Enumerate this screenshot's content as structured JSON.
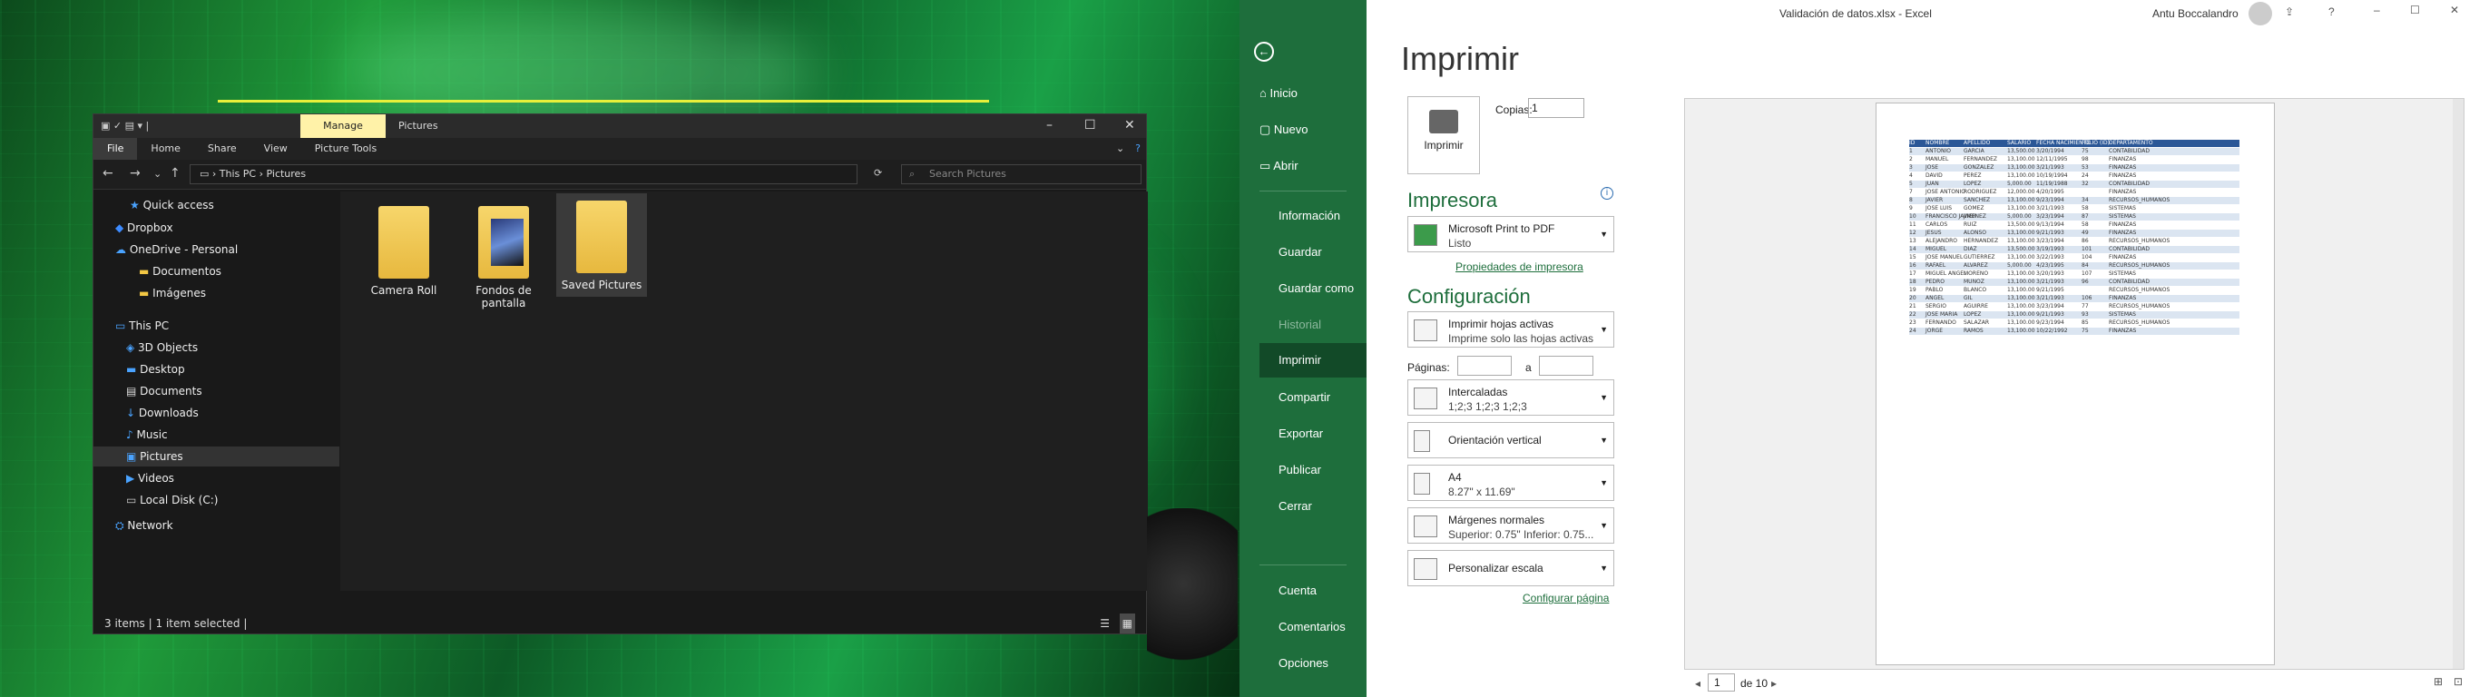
{
  "explorer": {
    "tab_manage": "Manage",
    "title": "Pictures",
    "ribbon": [
      "File",
      "Home",
      "Share",
      "View",
      "Picture Tools"
    ],
    "breadcrumb": [
      "This PC",
      "Pictures"
    ],
    "search_placeholder": "Search Pictures",
    "nav": [
      "Quick access",
      "Dropbox",
      "OneDrive - Personal",
      "Documentos",
      "Imágenes",
      "This PC",
      "3D Objects",
      "Desktop",
      "Documents",
      "Downloads",
      "Music",
      "Pictures",
      "Videos",
      "Local Disk (C:)",
      "Network"
    ],
    "folders": [
      "Camera Roll",
      "Fondos de pantalla",
      "Saved Pictures"
    ],
    "status": {
      "items": "3 items",
      "selected": "1 item selected"
    }
  },
  "excel": {
    "window_title": "Validación de datos.xlsx  -  Excel",
    "user": "Antu Boccalandro",
    "backstage": [
      "Inicio",
      "Nuevo",
      "Abrir",
      "Información",
      "Guardar",
      "Guardar como",
      "Historial",
      "Imprimir",
      "Compartir",
      "Exportar",
      "Publicar",
      "Cerrar",
      "Cuenta",
      "Comentarios",
      "Opciones"
    ],
    "heading": "Imprimir",
    "print_button": "Imprimir",
    "copies_label": "Copias:",
    "copies_value": "1",
    "printer_section": "Impresora",
    "printer_name": "Microsoft Print to PDF",
    "printer_status": "Listo",
    "printer_props": "Propiedades de impresora",
    "config_section": "Configuración",
    "settings": [
      {
        "t1": "Imprimir hojas activas",
        "t2": "Imprime solo las hojas activas"
      },
      {
        "t1": "Intercaladas",
        "t2": "1;2;3    1;2;3    1;2;3"
      },
      {
        "t1": "Orientación vertical",
        "t2": ""
      },
      {
        "t1": "A4",
        "t2": "8.27\" x 11.69\""
      },
      {
        "t1": "Márgenes normales",
        "t2": "Superior: 0.75\" Inferior: 0.75..."
      },
      {
        "t1": "Personalizar escala",
        "t2": ""
      }
    ],
    "pages_label": "Páginas:",
    "pages_to": "a",
    "page_setup": "Configurar página",
    "nav_page": "1",
    "nav_of": "de 10",
    "sheet_header": [
      "ID",
      "NOMBRE",
      "APELLIDO",
      "SALARIO",
      "FECHA NACIMIENTO",
      "FOLIO (ID)",
      "DEPARTAMENTO"
    ],
    "sheet_rows": [
      [
        "1",
        "ANTONIO",
        "GARCIA",
        "13,500.00",
        "3/20/1994",
        "75",
        "CONTABILIDAD"
      ],
      [
        "2",
        "MANUEL",
        "FERNANDEZ",
        "13,100.00",
        "12/11/1995",
        "98",
        "FINANZAS"
      ],
      [
        "3",
        "JOSE",
        "GONZALEZ",
        "13,100.00",
        "3/21/1993",
        "53",
        "FINANZAS"
      ],
      [
        "4",
        "DAVID",
        "PEREZ",
        "13,100.00",
        "10/19/1994",
        "24",
        "FINANZAS"
      ],
      [
        "5",
        "JUAN",
        "LOPEZ",
        "5,000.00",
        "11/19/1988",
        "32",
        "CONTABILIDAD"
      ],
      [
        "7",
        "JOSE ANTONIO",
        "RODRIGUEZ",
        "12,000.00",
        "4/20/1995",
        "",
        "FINANZAS"
      ],
      [
        "8",
        "JAVIER",
        "SANCHEZ",
        "13,100.00",
        "9/23/1994",
        "34",
        "RECURSOS_HUMANOS"
      ],
      [
        "9",
        "JOSE LUIS",
        "GOMEZ",
        "13,100.00",
        "3/21/1993",
        "58",
        "SISTEMAS"
      ],
      [
        "10",
        "FRANCISCO JAVIER",
        "JIMENEZ",
        "5,000.00",
        "3/23/1994",
        "87",
        "SISTEMAS"
      ],
      [
        "11",
        "CARLOS",
        "RUIZ",
        "13,500.00",
        "9/13/1994",
        "58",
        "FINANZAS"
      ],
      [
        "12",
        "JESUS",
        "ALONSO",
        "13,100.00",
        "9/21/1993",
        "49",
        "FINANZAS"
      ],
      [
        "13",
        "ALEJANDRO",
        "HERNANDEZ",
        "13,100.00",
        "3/23/1994",
        "86",
        "RECURSOS_HUMANOS"
      ],
      [
        "14",
        "MIGUEL",
        "DIAZ",
        "13,500.00",
        "3/19/1993",
        "101",
        "CONTABILIDAD"
      ],
      [
        "15",
        "JOSE MANUEL",
        "GUTIERREZ",
        "13,100.00",
        "3/22/1993",
        "104",
        "FINANZAS"
      ],
      [
        "16",
        "RAFAEL",
        "ALVAREZ",
        "5,000.00",
        "4/23/1995",
        "84",
        "RECURSOS_HUMANOS"
      ],
      [
        "17",
        "MIGUEL ANGEL",
        "MORENO",
        "13,100.00",
        "3/20/1993",
        "107",
        "SISTEMAS"
      ],
      [
        "18",
        "PEDRO",
        "MUÑOZ",
        "13,100.00",
        "3/21/1993",
        "96",
        "CONTABILIDAD"
      ],
      [
        "19",
        "PABLO",
        "BLANCO",
        "13,100.00",
        "9/21/1995",
        "",
        "RECURSOS_HUMANOS"
      ],
      [
        "20",
        "ANGEL",
        "GIL",
        "13,100.00",
        "3/21/1993",
        "106",
        "FINANZAS"
      ],
      [
        "21",
        "SERGIO",
        "AGUIRRE",
        "13,100.00",
        "3/23/1994",
        "77",
        "RECURSOS_HUMANOS"
      ],
      [
        "22",
        "JOSE MARIA",
        "LOPEZ",
        "13,100.00",
        "9/21/1993",
        "93",
        "SISTEMAS"
      ],
      [
        "23",
        "FERNANDO",
        "SALAZAR",
        "13,100.00",
        "9/23/1994",
        "85",
        "RECURSOS_HUMANOS"
      ],
      [
        "24",
        "JORGE",
        "RAMOS",
        "13,100.00",
        "10/22/1992",
        "75",
        "FINANZAS"
      ]
    ]
  }
}
